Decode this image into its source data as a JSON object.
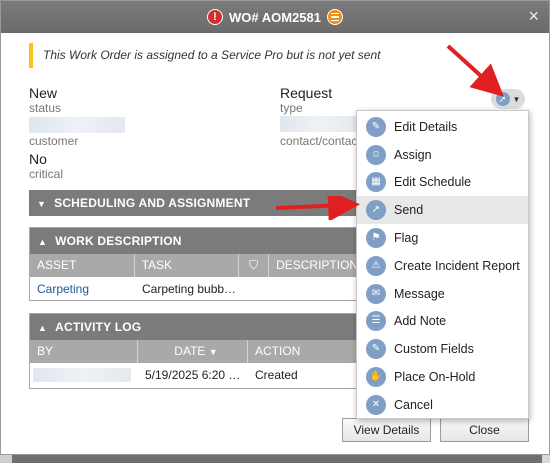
{
  "header": {
    "title": "WO# AOM2581",
    "close": "×"
  },
  "notice": "This Work Order is assigned to a Service Pro but is not yet sent",
  "fields": {
    "status_value": "New",
    "status_label": "status",
    "type_value": "Request",
    "type_label": "type",
    "customer_label": "customer",
    "contact_label": "contact/contact",
    "critical_value": "No",
    "critical_label": "critical"
  },
  "sections": {
    "scheduling": "SCHEDULING AND ASSIGNMENT",
    "work_description": {
      "title": "WORK DESCRIPTION",
      "columns": [
        "ASSET",
        "TASK",
        "",
        "DESCRIPTION"
      ],
      "rows": [
        {
          "asset": "Carpeting",
          "task": "Carpeting bubb…"
        }
      ]
    },
    "activity_log": {
      "title": "ACTIVITY LOG",
      "columns": [
        "BY",
        "DATE",
        "ACTION"
      ],
      "rows": [
        {
          "date": "5/19/2025 6:20 …",
          "action": "Created"
        }
      ]
    }
  },
  "buttons": {
    "view_details": "View Details",
    "close": "Close"
  },
  "menu": [
    {
      "label": "Edit Details",
      "icon": "pencil-icon"
    },
    {
      "label": "Assign",
      "icon": "person-icon"
    },
    {
      "label": "Edit Schedule",
      "icon": "calendar-icon"
    },
    {
      "label": "Send",
      "icon": "send-icon"
    },
    {
      "label": "Flag",
      "icon": "flag-icon"
    },
    {
      "label": "Create Incident Report",
      "icon": "warning-icon"
    },
    {
      "label": "Message",
      "icon": "envelope-icon"
    },
    {
      "label": "Add Note",
      "icon": "note-icon"
    },
    {
      "label": "Custom Fields",
      "icon": "pencil-icon"
    },
    {
      "label": "Place On-Hold",
      "icon": "hand-icon"
    },
    {
      "label": "Cancel",
      "icon": "cancel-icon"
    }
  ],
  "colors": {
    "header": "#7b7b7b",
    "accent_icon": "#7f9fc6",
    "alert": "#d32f2f",
    "notice_bar": "#f5c518",
    "annotation_arrow": "#e02020"
  }
}
